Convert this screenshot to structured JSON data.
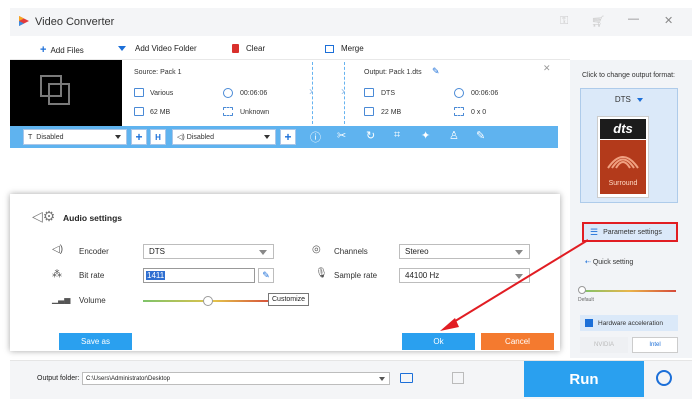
{
  "window": {
    "title": "Video Converter",
    "icons": [
      "key-icon",
      "cart-icon",
      "minimize-icon",
      "close-icon"
    ]
  },
  "toolbar": {
    "add_files": "Add Files",
    "add_video_folder": "Add Video Folder",
    "clear": "Clear",
    "merge": "Merge"
  },
  "file": {
    "source_label": "Source: Pack 1",
    "source_format": "Various",
    "source_duration": "00:06:06",
    "source_size": "62 MB",
    "source_resolution": "Unknown",
    "output_label": "Output: Pack 1.dts",
    "output_format": "DTS",
    "output_duration": "00:06:06",
    "output_size": "22 MB",
    "output_resolution": "0 x 0"
  },
  "editbar": {
    "subtitle": "Disabled",
    "audio_track": "Disabled"
  },
  "right_panel": {
    "hint": "Click to change output format:",
    "format_name": "DTS",
    "dts_logo_text": "dts",
    "dts_logo_sub": "Surround",
    "parameter_settings": "Parameter settings",
    "quick_setting": "Quick setting",
    "default_label": "Default",
    "hardware_acceleration": "Hardware acceleration",
    "nvidia": "NVIDIA",
    "intel": "Intel"
  },
  "dialog": {
    "title": "Audio settings",
    "encoder_label": "Encoder",
    "encoder_value": "DTS",
    "channels_label": "Channels",
    "channels_value": "Stereo",
    "bitrate_label": "Bit rate",
    "bitrate_value": "1411",
    "samplerate_label": "Sample rate",
    "samplerate_value": "44100 Hz",
    "volume_label": "Volume",
    "volume_level": 0.5,
    "tooltip": "Customize",
    "save_as": "Save as",
    "ok": "Ok",
    "cancel": "Cancel"
  },
  "bottom": {
    "output_folder_label": "Output folder:",
    "output_folder_value": "C:\\Users\\Administrator\\Desktop",
    "run": "Run"
  },
  "colors": {
    "accent_blue": "#2aa0ef",
    "edit_bar": "#5fb3ef",
    "cancel_orange": "#f47a2f",
    "highlight_red": "#e11d23"
  }
}
